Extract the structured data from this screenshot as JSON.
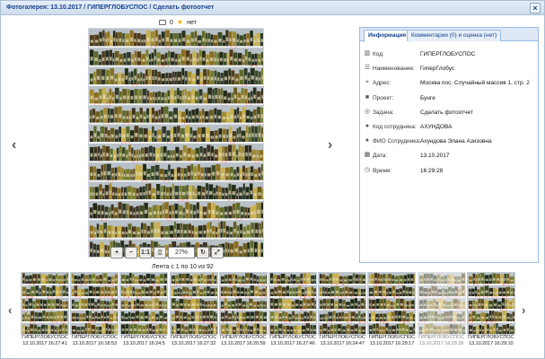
{
  "window": {
    "title": "Фотогалерея: 13.10.2017 / ГИПЕРГЛОБУСПОС / Сделать фотоотчет",
    "close_glyph": "×"
  },
  "stats": {
    "comments_count": "0",
    "rating_text": "нет",
    "comment_icon": "comment-icon",
    "rating_icon": "star-icon"
  },
  "viewer": {
    "prev_glyph": "‹",
    "next_glyph": "›",
    "zoom_value": "27%",
    "zoom_in_glyph": "+",
    "zoom_out_glyph": "−",
    "actual_size_label": "1:1",
    "ribbon_caption": "Лента с 1 по 10 из 92"
  },
  "info": {
    "tabs": [
      {
        "label": "Информация",
        "active": true
      },
      {
        "label": "Комментарии (0) и оценка (нет)",
        "active": false
      }
    ],
    "rows": [
      {
        "icon": "barcode-icon",
        "label": "Код:",
        "value": "ГИПЕРГЛОБУСПОС"
      },
      {
        "icon": "list-icon",
        "label": "Наименование:",
        "value": "ГиперГлобус"
      },
      {
        "icon": "location-icon",
        "label": "Адрес:",
        "value": "Москва пос. Случайный массив 1, стр. 2"
      },
      {
        "icon": "briefcase-icon",
        "label": "Проект:",
        "value": "Бунге"
      },
      {
        "icon": "target-icon",
        "label": "Задача:",
        "value": "Сделать фотоотчет"
      },
      {
        "icon": "user-icon",
        "label": "Код сотрудника:",
        "value": "АХУНДОВА"
      },
      {
        "icon": "user-icon",
        "label": "ФИО Сотрудника:",
        "value": "Ахундова Элана Азизовна"
      },
      {
        "icon": "calendar-icon",
        "label": "Дата:",
        "value": "13.10.2017"
      },
      {
        "icon": "clock-icon",
        "label": "Время:",
        "value": "16:29:28"
      }
    ]
  },
  "strip": {
    "prev_glyph": "‹",
    "next_glyph": "›",
    "thumbs": [
      {
        "store": "ГИПЕРГЛОБУСПОС",
        "datetime": "13.10.2017 16:27:41"
      },
      {
        "store": "ГИПЕРГЛОБУСПОС",
        "datetime": "13.10.2017 16:18:53"
      },
      {
        "store": "ГИПЕРГЛОБУСПОС",
        "datetime": "13.10.2017 16:24:5"
      },
      {
        "store": "ГИПЕРГЛОБУСПОС",
        "datetime": "13.10.2017 16:27:32"
      },
      {
        "store": "ГИПЕРГЛОБУСПОС",
        "datetime": "13.10.2017 16:20:59"
      },
      {
        "store": "ГИПЕРГЛОБУСПОС",
        "datetime": "13.10.2017 16:27:46"
      },
      {
        "store": "ГИПЕРГЛОБУСПОС",
        "datetime": "13.10.2017 16:24:47"
      },
      {
        "store": "ГИПЕРГЛОБУСПОС",
        "datetime": "13.10.2017 16:29:17"
      },
      {
        "store": "ГИПЕРГЛОБУСПОС",
        "datetime": "13.10.2017 16:29:28"
      },
      {
        "store": "ГИПЕРГЛОБУСПОС",
        "datetime": "13.10.2017 16:29:10"
      }
    ]
  },
  "colors": {
    "accent": "#15428b",
    "panel_border": "#99bbe8",
    "rating_star": "#f0b400"
  }
}
